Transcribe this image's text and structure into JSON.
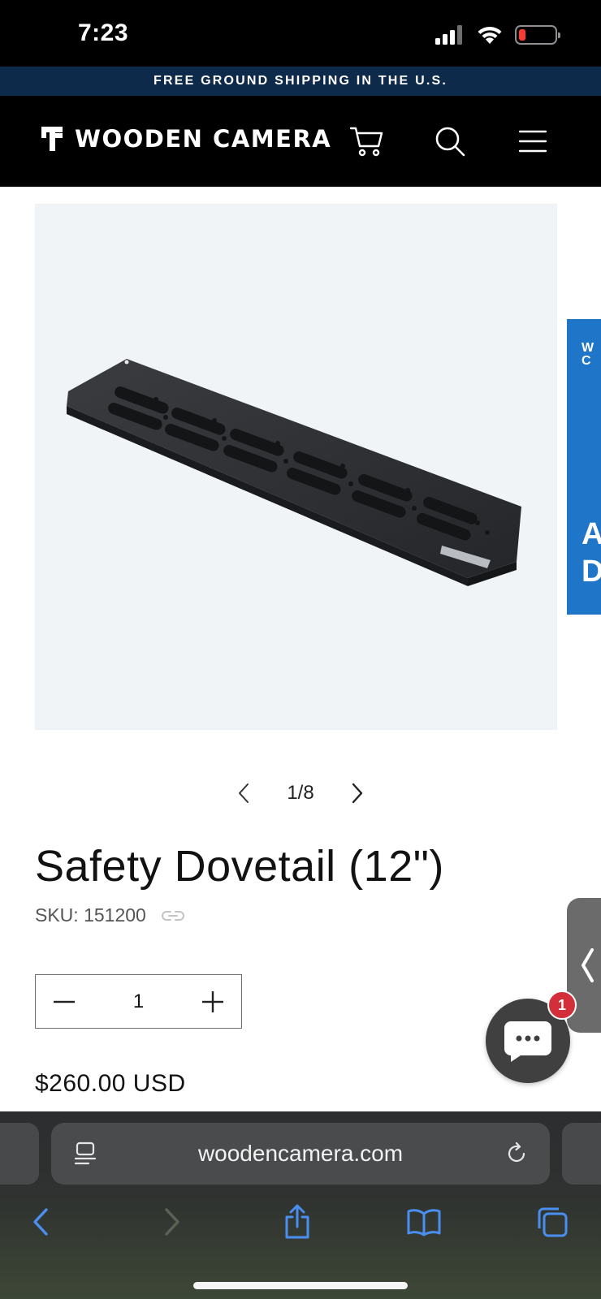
{
  "status_bar": {
    "time": "7:23",
    "icons": [
      "cellular-signal-icon",
      "wifi-icon",
      "battery-low-icon"
    ],
    "battery_color": "#ff3b30"
  },
  "announcement": {
    "text": "FREE GROUND SHIPPING IN THE U.S."
  },
  "header": {
    "logo_text": "WOODEN CAMERA",
    "icons": [
      "cart-icon",
      "search-icon",
      "menu-icon"
    ]
  },
  "gallery": {
    "position": "1/8",
    "prev_icon": "chevron-left-icon",
    "next_icon": "chevron-right-icon",
    "next_slide_text_top": "W\nC",
    "next_slide_text_bottom": "A\nD"
  },
  "product": {
    "title": "Safety Dovetail (12\")",
    "sku": "SKU: 151200",
    "sku_icon": "link-icon",
    "quantity": "1",
    "price": "$260.00 USD"
  },
  "chat": {
    "badge_count": "1",
    "icon": "chat-bubble-icon"
  },
  "side_tab": {
    "icon": "chevron-left-icon"
  },
  "browser": {
    "url": "woodencamera.com",
    "reader_icon": "page-menu-icon",
    "reload_icon": "reload-icon",
    "toolbar_icons": [
      "back-icon",
      "forward-icon",
      "share-icon",
      "bookmarks-icon",
      "tabs-icon"
    ]
  },
  "colors": {
    "announcement_bg": "#0e2a4a",
    "header_bg": "#000000",
    "accent_blue": "#1f75c8",
    "safari_icon": "#4a8ff0",
    "badge_red": "#d32f3a"
  }
}
